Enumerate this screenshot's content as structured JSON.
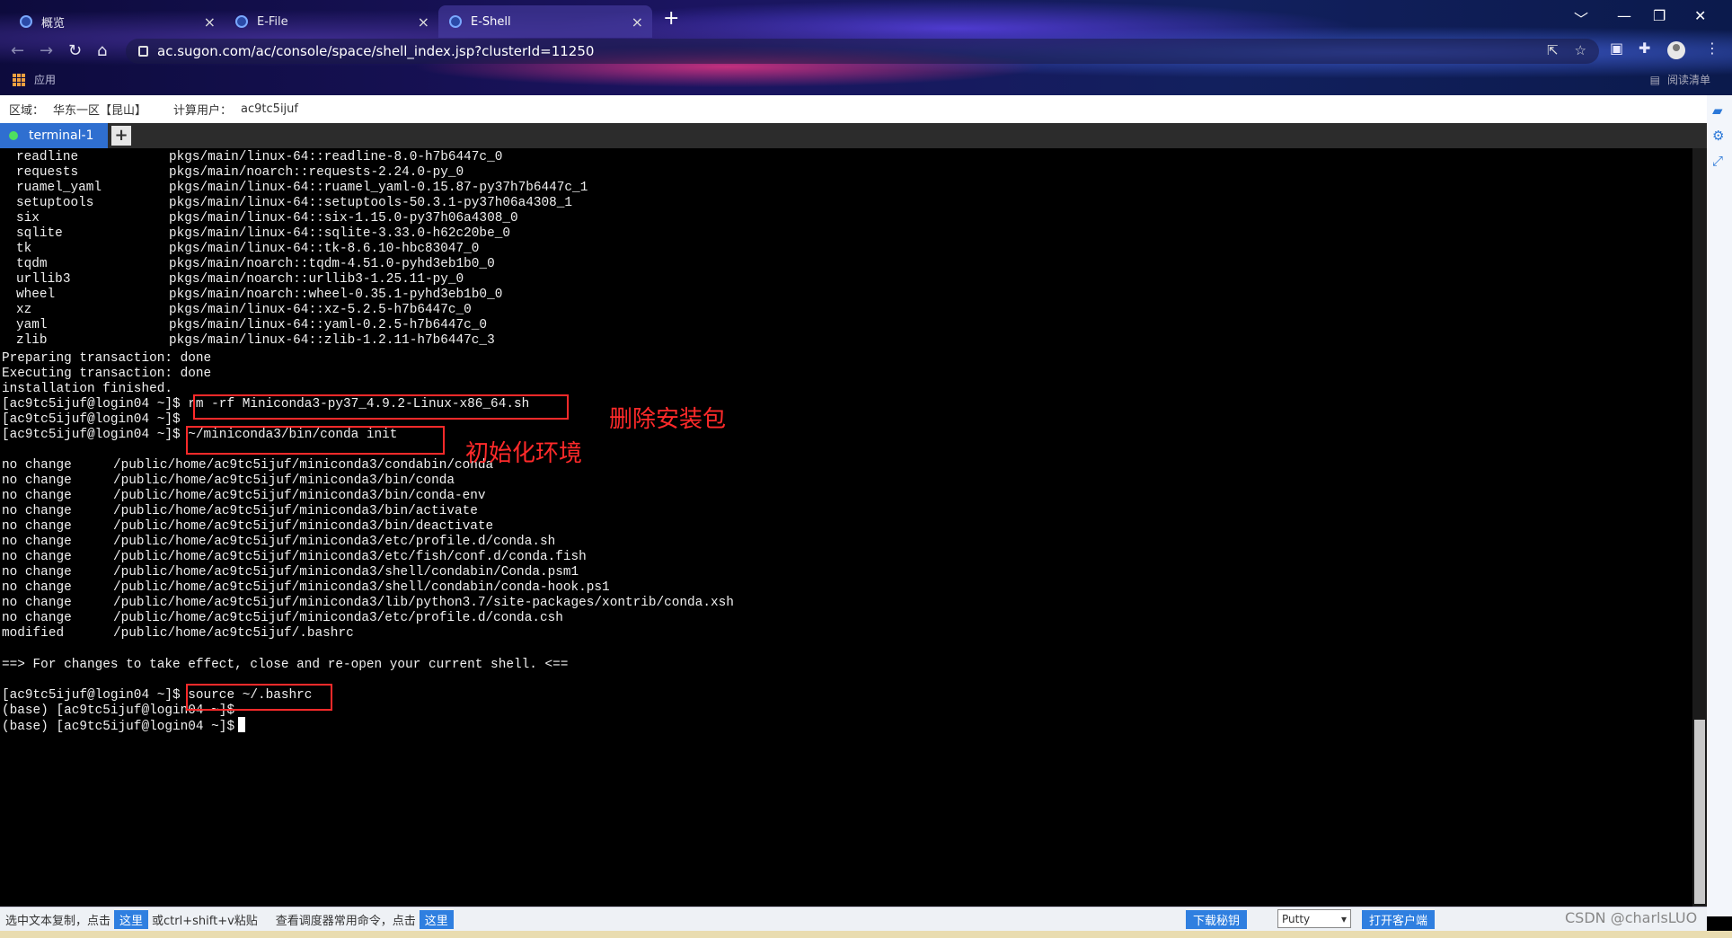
{
  "browser": {
    "tabs": [
      {
        "title": "概览",
        "close": "×"
      },
      {
        "title": "E-File",
        "close": "×"
      },
      {
        "title": "E-Shell",
        "close": "×"
      }
    ],
    "new_tab": "+",
    "window_controls": {
      "minimize": "﹀",
      "min": "—",
      "restore": "❐",
      "close": "✕"
    },
    "url": "ac.sugon.com/ac/console/space/shell_index.jsp?clusterId=11250",
    "apps_label": "应用",
    "reading_list": "阅读清单"
  },
  "info": {
    "region_label": "区域：",
    "region_value": "华东一区【昆山】",
    "user_label": "计算用户：",
    "user_value": "ac9tc5ijuf"
  },
  "terminal_tab": {
    "label": "terminal-1",
    "add": "+"
  },
  "packages": [
    {
      "name": "readline",
      "spec": "pkgs/main/linux-64::readline-8.0-h7b6447c_0"
    },
    {
      "name": "requests",
      "spec": "pkgs/main/noarch::requests-2.24.0-py_0"
    },
    {
      "name": "ruamel_yaml",
      "spec": "pkgs/main/linux-64::ruamel_yaml-0.15.87-py37h7b6447c_1"
    },
    {
      "name": "setuptools",
      "spec": "pkgs/main/linux-64::setuptools-50.3.1-py37h06a4308_1"
    },
    {
      "name": "six",
      "spec": "pkgs/main/linux-64::six-1.15.0-py37h06a4308_0"
    },
    {
      "name": "sqlite",
      "spec": "pkgs/main/linux-64::sqlite-3.33.0-h62c20be_0"
    },
    {
      "name": "tk",
      "spec": "pkgs/main/linux-64::tk-8.6.10-hbc83047_0"
    },
    {
      "name": "tqdm",
      "spec": "pkgs/main/noarch::tqdm-4.51.0-pyhd3eb1b0_0"
    },
    {
      "name": "urllib3",
      "spec": "pkgs/main/noarch::urllib3-1.25.11-py_0"
    },
    {
      "name": "wheel",
      "spec": "pkgs/main/noarch::wheel-0.35.1-pyhd3eb1b0_0"
    },
    {
      "name": "xz",
      "spec": "pkgs/main/linux-64::xz-5.2.5-h7b6447c_0"
    },
    {
      "name": "yaml",
      "spec": "pkgs/main/linux-64::yaml-0.2.5-h7b6447c_0"
    },
    {
      "name": "zlib",
      "spec": "pkgs/main/linux-64::zlib-1.2.11-h7b6447c_3"
    }
  ],
  "lines": {
    "preparing": "Preparing transaction: done",
    "executing": "Executing transaction: done",
    "finished": "installation finished.",
    "prompt1": "[ac9tc5ijuf@login04 ~]$ ",
    "cmd_rm": "rm -rf Miniconda3-py37_4.9.2-Linux-x86_64.sh",
    "prompt2": "[ac9tc5ijuf@login04 ~]$",
    "prompt3": "[ac9tc5ijuf@login04 ~]$ ",
    "cmd_init": "~/miniconda3/bin/conda init",
    "effect": "==> For changes to take effect, close and re-open your current shell. <==",
    "prompt4": "[ac9tc5ijuf@login04 ~]$ ",
    "cmd_source": "source ~/.bashrc",
    "base1": "(base) [ac9tc5ijuf@login04 ~]$",
    "base2": "(base) [ac9tc5ijuf@login04 ~]$"
  },
  "changes": [
    {
      "status": "no change",
      "path": "/public/home/ac9tc5ijuf/miniconda3/condabin/conda"
    },
    {
      "status": "no change",
      "path": "/public/home/ac9tc5ijuf/miniconda3/bin/conda"
    },
    {
      "status": "no change",
      "path": "/public/home/ac9tc5ijuf/miniconda3/bin/conda-env"
    },
    {
      "status": "no change",
      "path": "/public/home/ac9tc5ijuf/miniconda3/bin/activate"
    },
    {
      "status": "no change",
      "path": "/public/home/ac9tc5ijuf/miniconda3/bin/deactivate"
    },
    {
      "status": "no change",
      "path": "/public/home/ac9tc5ijuf/miniconda3/etc/profile.d/conda.sh"
    },
    {
      "status": "no change",
      "path": "/public/home/ac9tc5ijuf/miniconda3/etc/fish/conf.d/conda.fish"
    },
    {
      "status": "no change",
      "path": "/public/home/ac9tc5ijuf/miniconda3/shell/condabin/Conda.psm1"
    },
    {
      "status": "no change",
      "path": "/public/home/ac9tc5ijuf/miniconda3/shell/condabin/conda-hook.ps1"
    },
    {
      "status": "no change",
      "path": "/public/home/ac9tc5ijuf/miniconda3/lib/python3.7/site-packages/xontrib/conda.xsh"
    },
    {
      "status": "no change",
      "path": "/public/home/ac9tc5ijuf/miniconda3/etc/profile.d/conda.csh"
    },
    {
      "status": "modified",
      "path": "/public/home/ac9tc5ijuf/.bashrc"
    }
  ],
  "annotations": {
    "delete_pkg": "删除安装包",
    "init_env": "初始化环境"
  },
  "bottom": {
    "copy_hint": "选中文本复制，点击",
    "here1": "这里",
    "paste_hint": "或ctrl+shift+v粘贴",
    "cmd_hint": "查看调度器常用命令，点击",
    "here2": "这里",
    "download_key": "下载秘钥",
    "client_select": "Putty",
    "open_client": "打开客户端",
    "watermark": "CSDN @charlsLUO"
  },
  "colors": {
    "accent": "#2f7fe0",
    "annotation": "#ff2a2a",
    "terminal_bg": "#000000",
    "terminal_fg": "#f0f0f0"
  }
}
